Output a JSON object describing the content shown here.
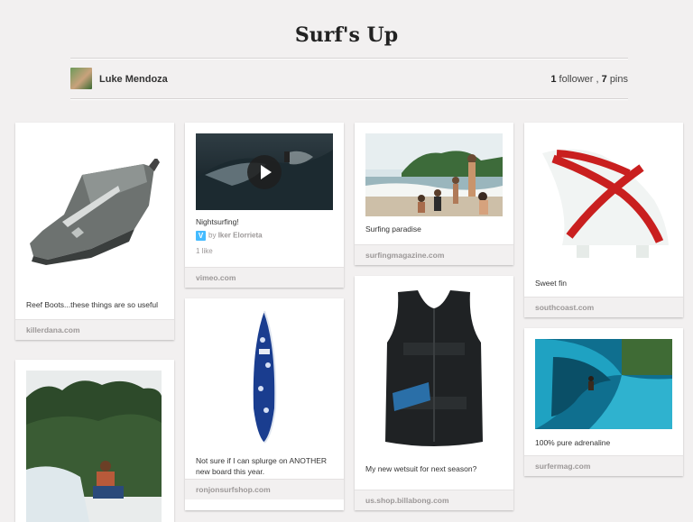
{
  "board": {
    "title": "Surf's Up",
    "owner": "Luke Mendoza",
    "followers_count": "1",
    "followers_label": "follower ,",
    "pins_count": "7",
    "pins_label": "pins"
  },
  "pins": [
    {
      "caption": "Reef Boots...these things are so useful",
      "source": "killerdana.com"
    },
    {
      "caption": "Nightsurfing!",
      "via_label": "by",
      "via_author": "Iker Elorrieta",
      "likes": "1 like",
      "source": "vimeo.com"
    },
    {
      "caption": "Surfing paradise",
      "source": "surfingmagazine.com"
    },
    {
      "caption": "Sweet fin",
      "source": "southcoast.com"
    },
    {
      "caption": "Not sure if I can splurge on ANOTHER new board this year.",
      "source": "ronjonsurfshop.com"
    },
    {
      "caption": "My new wetsuit for next season?",
      "source": "us.shop.billabong.com"
    },
    {
      "caption": "100% pure adrenaline",
      "source": "surfermag.com"
    },
    {
      "caption": "",
      "source": ""
    }
  ],
  "icons": {
    "play": "play-icon",
    "vimeo": "vimeo-logo-icon"
  },
  "colors": {
    "background": "#f2f0f0",
    "source_text": "#9c9898",
    "vimeo": "#44bbff"
  }
}
